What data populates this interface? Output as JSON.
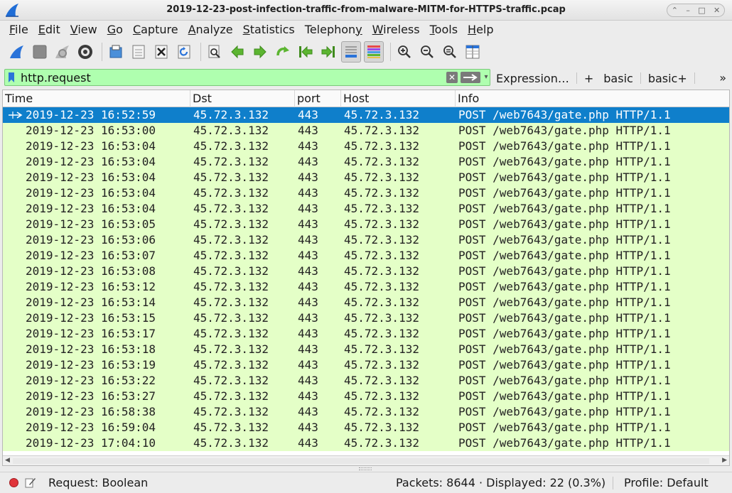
{
  "window": {
    "title": "2019-12-23-post-infection-traffic-from-malware-MITM-for-HTTPS-traffic.pcap",
    "controls": [
      "⌃",
      "–",
      "□",
      "✕"
    ]
  },
  "menu": [
    {
      "label": "File",
      "accel": "F",
      "rest": "ile"
    },
    {
      "label": "Edit",
      "accel": "E",
      "rest": "dit"
    },
    {
      "label": "View",
      "accel": "V",
      "rest": "iew"
    },
    {
      "label": "Go",
      "accel": "G",
      "rest": "o"
    },
    {
      "label": "Capture",
      "accel": "C",
      "rest": "apture"
    },
    {
      "label": "Analyze",
      "accel": "A",
      "rest": "nalyze"
    },
    {
      "label": "Statistics",
      "accel": "S",
      "rest": "tatistics"
    },
    {
      "label": "Telephony",
      "pre": "Telephon",
      "accel": "y",
      "rest": ""
    },
    {
      "label": "Wireless",
      "accel": "W",
      "rest": "ireless"
    },
    {
      "label": "Tools",
      "accel": "T",
      "rest": "ools"
    },
    {
      "label": "Help",
      "accel": "H",
      "rest": "elp"
    }
  ],
  "toolbar_icons": [
    "start-capture-icon",
    "stop-capture-icon",
    "restart-capture-icon",
    "capture-options-icon",
    "open-file-icon",
    "save-file-icon",
    "close-file-icon",
    "reload-file-icon",
    "find-packet-icon",
    "go-back-icon",
    "go-forward-icon",
    "go-to-packet-icon",
    "go-first-icon",
    "go-last-icon",
    "autoscroll-icon",
    "colorize-icon",
    "zoom-in-icon",
    "zoom-out-icon",
    "zoom-normal-icon",
    "resize-columns-icon"
  ],
  "filter": {
    "value": "http.request",
    "color": "#afffaf",
    "clear_glyph": "✕",
    "expression_label": "Expression…",
    "plus_label": "+",
    "buttons": [
      "basic",
      "basic+"
    ],
    "overflow": "»"
  },
  "columns": [
    "Time",
    "Dst",
    "port",
    "Host",
    "Info"
  ],
  "rows": [
    {
      "time": "2019-12-23 16:52:59",
      "dst": "45.72.3.132",
      "port": "443",
      "host": "45.72.3.132",
      "info": "POST /web7643/gate.php HTTP/1.1",
      "selected": true
    },
    {
      "time": "2019-12-23 16:53:00",
      "dst": "45.72.3.132",
      "port": "443",
      "host": "45.72.3.132",
      "info": "POST /web7643/gate.php HTTP/1.1"
    },
    {
      "time": "2019-12-23 16:53:04",
      "dst": "45.72.3.132",
      "port": "443",
      "host": "45.72.3.132",
      "info": "POST /web7643/gate.php HTTP/1.1"
    },
    {
      "time": "2019-12-23 16:53:04",
      "dst": "45.72.3.132",
      "port": "443",
      "host": "45.72.3.132",
      "info": "POST /web7643/gate.php HTTP/1.1"
    },
    {
      "time": "2019-12-23 16:53:04",
      "dst": "45.72.3.132",
      "port": "443",
      "host": "45.72.3.132",
      "info": "POST /web7643/gate.php HTTP/1.1"
    },
    {
      "time": "2019-12-23 16:53:04",
      "dst": "45.72.3.132",
      "port": "443",
      "host": "45.72.3.132",
      "info": "POST /web7643/gate.php HTTP/1.1"
    },
    {
      "time": "2019-12-23 16:53:04",
      "dst": "45.72.3.132",
      "port": "443",
      "host": "45.72.3.132",
      "info": "POST /web7643/gate.php HTTP/1.1"
    },
    {
      "time": "2019-12-23 16:53:05",
      "dst": "45.72.3.132",
      "port": "443",
      "host": "45.72.3.132",
      "info": "POST /web7643/gate.php HTTP/1.1"
    },
    {
      "time": "2019-12-23 16:53:06",
      "dst": "45.72.3.132",
      "port": "443",
      "host": "45.72.3.132",
      "info": "POST /web7643/gate.php HTTP/1.1"
    },
    {
      "time": "2019-12-23 16:53:07",
      "dst": "45.72.3.132",
      "port": "443",
      "host": "45.72.3.132",
      "info": "POST /web7643/gate.php HTTP/1.1"
    },
    {
      "time": "2019-12-23 16:53:08",
      "dst": "45.72.3.132",
      "port": "443",
      "host": "45.72.3.132",
      "info": "POST /web7643/gate.php HTTP/1.1"
    },
    {
      "time": "2019-12-23 16:53:12",
      "dst": "45.72.3.132",
      "port": "443",
      "host": "45.72.3.132",
      "info": "POST /web7643/gate.php HTTP/1.1"
    },
    {
      "time": "2019-12-23 16:53:14",
      "dst": "45.72.3.132",
      "port": "443",
      "host": "45.72.3.132",
      "info": "POST /web7643/gate.php HTTP/1.1"
    },
    {
      "time": "2019-12-23 16:53:15",
      "dst": "45.72.3.132",
      "port": "443",
      "host": "45.72.3.132",
      "info": "POST /web7643/gate.php HTTP/1.1"
    },
    {
      "time": "2019-12-23 16:53:17",
      "dst": "45.72.3.132",
      "port": "443",
      "host": "45.72.3.132",
      "info": "POST /web7643/gate.php HTTP/1.1"
    },
    {
      "time": "2019-12-23 16:53:18",
      "dst": "45.72.3.132",
      "port": "443",
      "host": "45.72.3.132",
      "info": "POST /web7643/gate.php HTTP/1.1"
    },
    {
      "time": "2019-12-23 16:53:19",
      "dst": "45.72.3.132",
      "port": "443",
      "host": "45.72.3.132",
      "info": "POST /web7643/gate.php HTTP/1.1"
    },
    {
      "time": "2019-12-23 16:53:22",
      "dst": "45.72.3.132",
      "port": "443",
      "host": "45.72.3.132",
      "info": "POST /web7643/gate.php HTTP/1.1"
    },
    {
      "time": "2019-12-23 16:53:27",
      "dst": "45.72.3.132",
      "port": "443",
      "host": "45.72.3.132",
      "info": "POST /web7643/gate.php HTTP/1.1"
    },
    {
      "time": "2019-12-23 16:58:38",
      "dst": "45.72.3.132",
      "port": "443",
      "host": "45.72.3.132",
      "info": "POST /web7643/gate.php HTTP/1.1"
    },
    {
      "time": "2019-12-23 16:59:04",
      "dst": "45.72.3.132",
      "port": "443",
      "host": "45.72.3.132",
      "info": "POST /web7643/gate.php HTTP/1.1"
    },
    {
      "time": "2019-12-23 17:04:10",
      "dst": "45.72.3.132",
      "port": "443",
      "host": "45.72.3.132",
      "info": "POST /web7643/gate.php HTTP/1.1"
    }
  ],
  "colors": {
    "row_bg": "#e4ffc7",
    "selected_bg": "#0f7fcb",
    "status_error": "#e0343a"
  },
  "status": {
    "field": "Request: Boolean",
    "packets": "Packets: 8644 · Displayed: 22 (0.3%)",
    "profile": "Profile: Default"
  }
}
